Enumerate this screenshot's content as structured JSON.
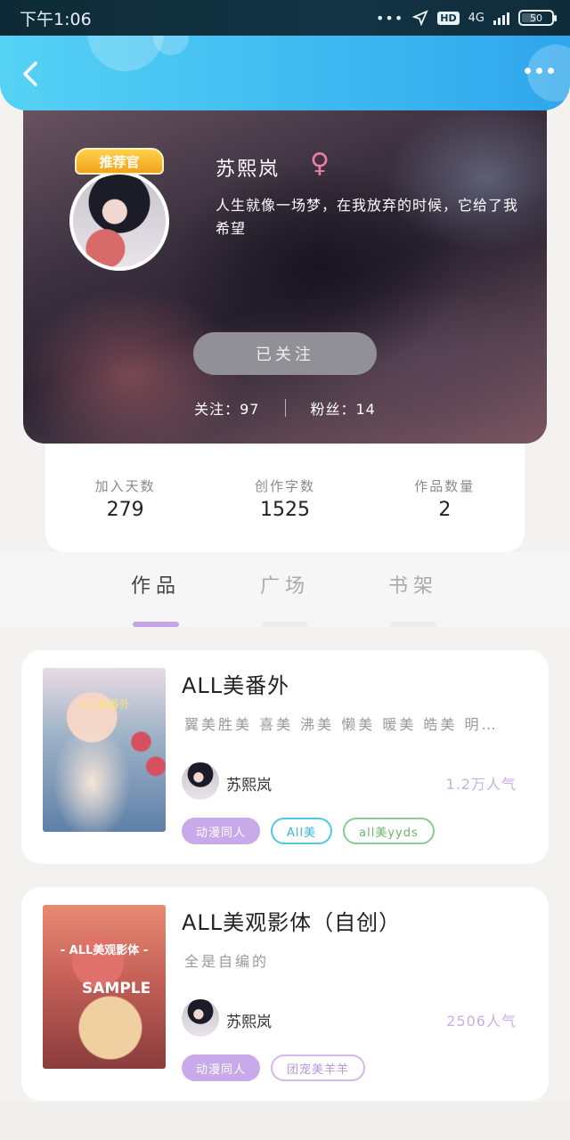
{
  "status_bar": {
    "time": "下午1:06",
    "network": "4G",
    "hd": "HD",
    "battery": "50",
    "battery_level": 0.5
  },
  "profile": {
    "badge": "推荐官",
    "name": "苏熙岚",
    "gender_symbol": "♀",
    "bio": "人生就像一场梦，在我放弃的时候，它给了我希望",
    "follow_button": "已关注",
    "following": "关注：97",
    "fans": "粉丝：14"
  },
  "stats": [
    {
      "label": "加入天数",
      "value": "279"
    },
    {
      "label": "创作字数",
      "value": "1525"
    },
    {
      "label": "作品数量",
      "value": "2"
    }
  ],
  "tabs": [
    {
      "label": "作品",
      "active": true
    },
    {
      "label": "广场",
      "active": false
    },
    {
      "label": "书架",
      "active": false
    }
  ],
  "works": [
    {
      "cover_text": "ALL美番外",
      "title": "ALL美番外",
      "desc": "翼美胜美 喜美 沸美 懒美 暖美 皓美 明…",
      "author": "苏熙岚",
      "popularity": "1.2万人气",
      "tags": [
        {
          "label": "动漫同人",
          "style": "filled"
        },
        {
          "label": "All美",
          "style": "cyan"
        },
        {
          "label": "all美yyds",
          "style": "green"
        }
      ]
    },
    {
      "cover_text": "- ALL美观影体 -",
      "cover_sample": "SAMPLE",
      "title": "ALL美观影体（自创）",
      "desc": "全是自编的",
      "author": "苏熙岚",
      "popularity": "2506人气",
      "tags": [
        {
          "label": "动漫同人",
          "style": "filled"
        },
        {
          "label": "团宠美羊羊",
          "style": "lilac"
        }
      ]
    }
  ],
  "colors": {
    "nav_gradient_start": "#56d2f5",
    "nav_gradient_end": "#2fa6ec",
    "accent_purple": "#c8aaea",
    "popularity": "#c8aee8"
  }
}
